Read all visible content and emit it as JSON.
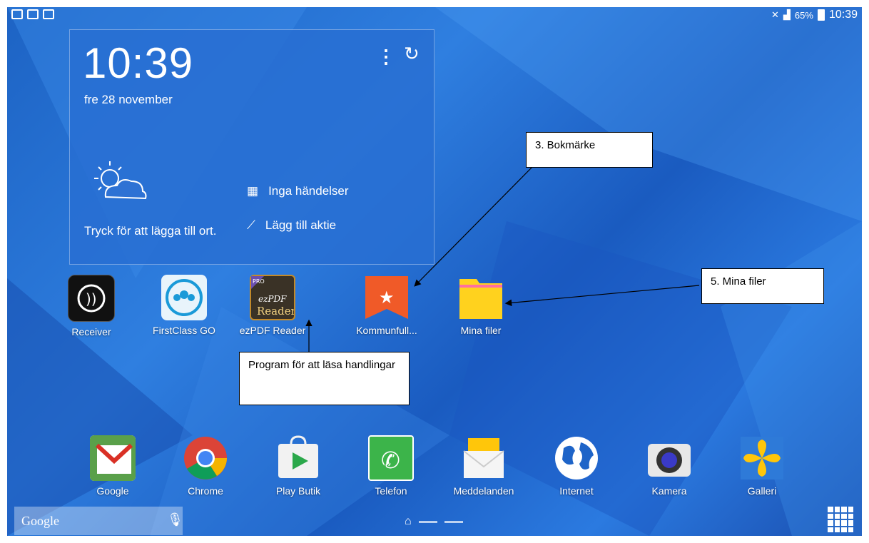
{
  "status_bar": {
    "battery": "65%",
    "time": "10:39"
  },
  "widget": {
    "time": "10:39",
    "date": "fre 28 november",
    "weather_prompt": "Tryck för att lägga till ort.",
    "events": "Inga händelser",
    "stock": "Lägg till aktie"
  },
  "apps_row1": [
    {
      "label": "Receiver",
      "icon": "receiver-icon"
    },
    {
      "label": "FirstClass GO",
      "icon": "firstclass-icon"
    },
    {
      "label": "ezPDF Reader",
      "icon": "ezpdf-icon"
    },
    {
      "label": "Kommunfull...",
      "icon": "bookmark-star-icon"
    },
    {
      "label": "Mina filer",
      "icon": "folder-icon"
    }
  ],
  "ezpdf_icon": {
    "badge": "PRO",
    "brand": "ezPDF",
    "word": "Reader"
  },
  "dock": [
    {
      "label": "Google",
      "icon": "gmail-icon"
    },
    {
      "label": "Chrome",
      "icon": "chrome-icon"
    },
    {
      "label": "Play Butik",
      "icon": "play-store-icon"
    },
    {
      "label": "Telefon",
      "icon": "phone-icon"
    },
    {
      "label": "Meddelanden",
      "icon": "messages-icon"
    },
    {
      "label": "Internet",
      "icon": "globe-icon"
    },
    {
      "label": "Kamera",
      "icon": "camera-icon"
    },
    {
      "label": "Galleri",
      "icon": "gallery-icon"
    }
  ],
  "callouts": {
    "bookmark": "3. Bokmärke",
    "files": "5. Mina filer",
    "reader": "Program för att läsa handlingar"
  },
  "search": {
    "logo": "Google"
  },
  "colors": {
    "wallpaper": "#2a72d8",
    "widget": "#2e72d4",
    "bookmark": "#f05a28",
    "folder": "#ffd21e"
  }
}
